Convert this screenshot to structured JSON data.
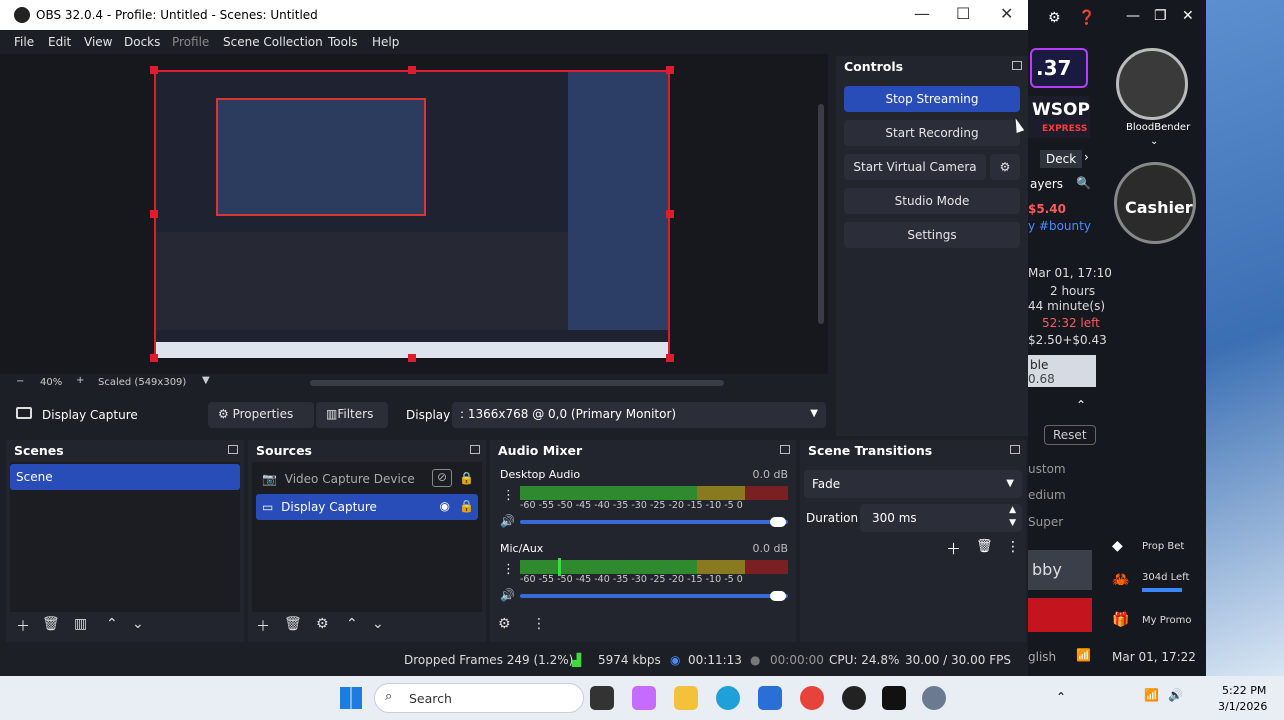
{
  "window": {
    "title": "OBS 32.0.4 - Profile: Untitled - Scenes: Untitled"
  },
  "menu": [
    "File",
    "Edit",
    "View",
    "Docks",
    "Profile",
    "Scene Collection",
    "Tools",
    "Help"
  ],
  "preview": {
    "zoom": "40%",
    "scaled": "Scaled (549x309)"
  },
  "context": {
    "source_name": "Display Capture",
    "properties": "Properties",
    "filters": "Filters",
    "display_label": "Display",
    "display_value": ": 1366x768 @ 0,0 (Primary Monitor)"
  },
  "controls": {
    "title": "Controls",
    "stop_streaming": "Stop Streaming",
    "start_recording": "Start Recording",
    "start_virtual_camera": "Start Virtual Camera",
    "studio_mode": "Studio Mode",
    "settings": "Settings"
  },
  "scenes": {
    "title": "Scenes",
    "items": [
      "Scene"
    ]
  },
  "sources": {
    "title": "Sources",
    "items": [
      "Video Capture Device",
      "Display Capture"
    ]
  },
  "mixer": {
    "title": "Audio Mixer",
    "channels": [
      {
        "name": "Desktop Audio",
        "db": "0.0 dB"
      },
      {
        "name": "Mic/Aux",
        "db": "0.0 dB"
      }
    ],
    "ticks": [
      "-60",
      "-55",
      "-50",
      "-45",
      "-40",
      "-35",
      "-30",
      "-25",
      "-20",
      "-15",
      "-10",
      "-5",
      "0"
    ]
  },
  "transitions": {
    "title": "Scene Transitions",
    "type": "Fade",
    "duration_label": "Duration",
    "duration_value": "300 ms"
  },
  "status": {
    "dropped": "Dropped Frames 249 (1.2%)",
    "bitrate": "5974 kbps",
    "stream_time": "00:11:13",
    "rec_time": "00:00:00",
    "cpu": "CPU: 24.8%",
    "fps": "30.00 / 30.00 FPS"
  },
  "poker": {
    "big_num": ".37",
    "wsop": "WSOP",
    "express": "EXPRESS",
    "player": "BloodBender",
    "deck": "Deck",
    "players": "ayers",
    "cashier": "Cashier",
    "amount": "$5.40",
    "hashtag": "y #bounty",
    "date1": "Mar 01, 17:10",
    "hours": "2 hours",
    "minutes": "44 minute(s)",
    "left": "52:32 left",
    "blinds": "$2.50+$0.43",
    "ble": "ble",
    "ble_val": "0.68",
    "reset": "Reset",
    "custom": "ustom",
    "medium": "edium",
    "super": "Super",
    "lobby": "bby",
    "prop_bet": "Prop Bet",
    "left_304": "304d Left",
    "my_promo": "My Promo",
    "glish": "glish",
    "date2": "Mar 01, 17:22"
  },
  "taskbar": {
    "search": "Search",
    "time": "5:22 PM",
    "date": "3/1/2026"
  }
}
